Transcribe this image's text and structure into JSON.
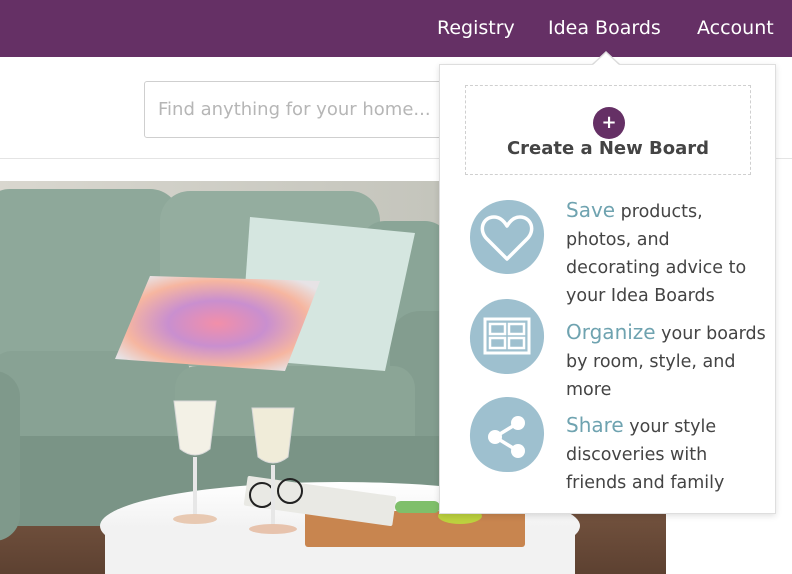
{
  "nav": {
    "registry": "Registry",
    "idea_boards": "Idea Boards",
    "account": "Account"
  },
  "search": {
    "placeholder": "Find anything for your home..."
  },
  "dropdown": {
    "create_icon": "+",
    "create_label": "Create a New Board",
    "features": [
      {
        "icon": "heart-icon",
        "key": "Save",
        "text": " products, photos, and decorating advice to your Idea Boards"
      },
      {
        "icon": "grid-icon",
        "key": "Organize",
        "text": " your boards by room, style, and more"
      },
      {
        "icon": "share-icon",
        "key": "Share",
        "text": " your style discoveries with friends and family"
      }
    ]
  },
  "colors": {
    "brand_purple": "#653065",
    "accent_teal": "#6fa3b0",
    "icon_blob": "#9ec0cf"
  }
}
